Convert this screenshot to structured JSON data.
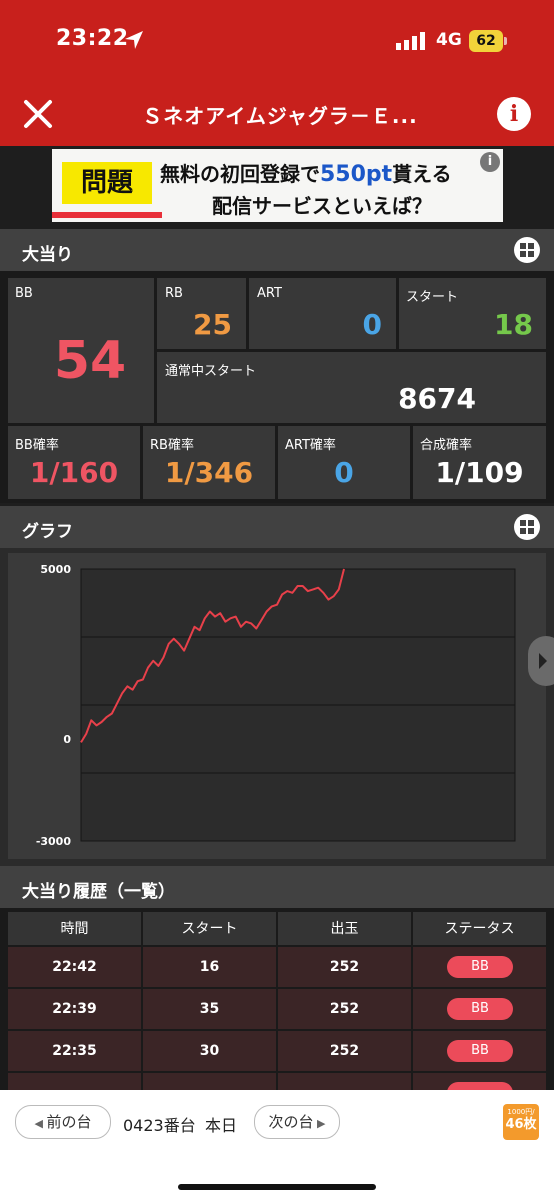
{
  "status_bar": {
    "time": "23:22",
    "network": "4G",
    "battery": "62"
  },
  "header": {
    "title": "Ｓネオアイムジャグラ－Ｅ..."
  },
  "ad": {
    "tag": "問題",
    "line1_a": "無料の初回登録で",
    "line1_b": "550pt",
    "line1_c": "貰える",
    "line2": "配信サービスといえば？"
  },
  "jackpot": {
    "section_label": "大当り",
    "bb": {
      "label": "BB",
      "value": "54"
    },
    "rb": {
      "label": "RB",
      "value": "25"
    },
    "art": {
      "label": "ART",
      "value": "0"
    },
    "start": {
      "label": "スタート",
      "value": "18"
    },
    "normal_start": {
      "label": "通常中スタート",
      "value": "8674"
    },
    "bb_rate": {
      "label": "BB確率",
      "value": "1/160"
    },
    "rb_rate": {
      "label": "RB確率",
      "value": "1/346"
    },
    "art_rate": {
      "label": "ART確率",
      "value": "0"
    },
    "combined_rate": {
      "label": "合成確率",
      "value": "1/109"
    }
  },
  "graph": {
    "section_label": "グラフ"
  },
  "chart_data": {
    "type": "line",
    "ylim": [
      -3000,
      5000
    ],
    "yticks": [
      "5000",
      "0",
      "-3000"
    ],
    "grid": true,
    "series": [
      {
        "color": "#e8404a",
        "values": [
          -100,
          150,
          550,
          400,
          500,
          650,
          750,
          1050,
          1350,
          1550,
          1450,
          1700,
          1750,
          2100,
          2300,
          2150,
          2400,
          2800,
          2950,
          2800,
          2600,
          2950,
          3300,
          3200,
          3550,
          3750,
          3600,
          3700,
          3450,
          3550,
          3600,
          3300,
          3450,
          3400,
          3250,
          3500,
          3750,
          3900,
          3950,
          4250,
          4350,
          4300,
          4500,
          4500,
          4350,
          4400,
          4450,
          4300,
          4100,
          4200,
          4400,
          5000
        ]
      }
    ]
  },
  "history": {
    "section_label": "大当り履歴（一覧）",
    "columns": [
      "時間",
      "スタート",
      "出玉",
      "ステータス"
    ],
    "rows": [
      {
        "time": "22:42",
        "start": "16",
        "payout": "252",
        "status": "BB"
      },
      {
        "time": "22:39",
        "start": "35",
        "payout": "252",
        "status": "BB"
      },
      {
        "time": "22:35",
        "start": "30",
        "payout": "252",
        "status": "BB"
      }
    ]
  },
  "bottom_bar": {
    "prev": "前の台",
    "machine_no": "0423番台",
    "day": "本日",
    "next": "次の台",
    "rate_top": "1000円/",
    "rate_bottom": "46枚"
  }
}
